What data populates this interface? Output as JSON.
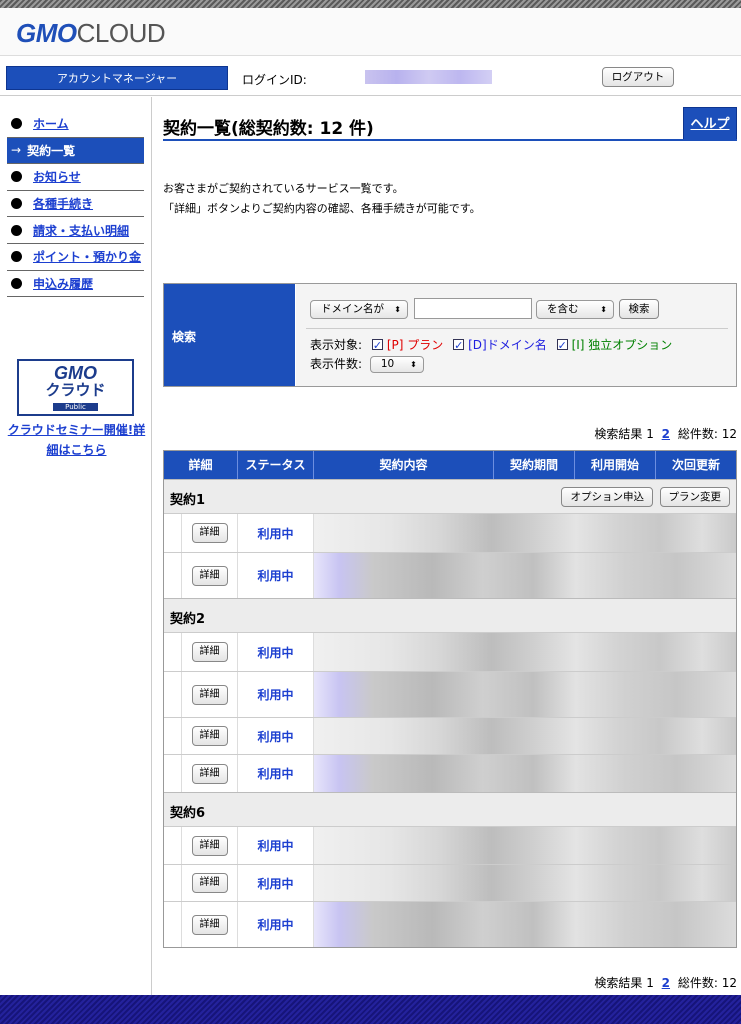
{
  "brand": {
    "gmo": "GMO",
    "cloud": "CLOUD"
  },
  "account": {
    "tab_label": "アカウントマネージャー",
    "login_label": "ログインID:",
    "logout_label": "ログアウト"
  },
  "sidebar": {
    "items": [
      {
        "label": "ホーム",
        "active": false
      },
      {
        "label": "契約一覧",
        "active": true
      },
      {
        "label": "お知らせ",
        "active": false
      },
      {
        "label": "各種手続き",
        "active": false
      },
      {
        "label": "請求・支払い明細",
        "active": false
      },
      {
        "label": "ポイント・預かり金",
        "active": false
      },
      {
        "label": "申込み履歴",
        "active": false
      }
    ],
    "active_arrow": "→",
    "badge": {
      "line1": "GMO",
      "line2": "クラウド",
      "line3": "Public"
    },
    "seminar_link": "クラウドセミナー開催!詳細はこちら"
  },
  "main": {
    "title": "契約一覧(総契約数: 12 件)",
    "help_label": "ヘルプ",
    "desc_line1": "お客さまがご契約されているサービス一覧です。",
    "desc_line2": "「詳細」ボタンよりご契約内容の確認、各種手続きが可能です。"
  },
  "search": {
    "label": "検索",
    "field_select": "ドメイン名が",
    "match_select": "を含む",
    "keyword_value": "",
    "search_button": "検索",
    "target_label": "表示対象:",
    "filters": {
      "plan": "[P] プラン",
      "domain": "[D]ドメイン名",
      "option": "[I] 独立オプション"
    },
    "count_label": "表示件数:",
    "count_value": "10"
  },
  "pagination": {
    "prefix": "検索結果",
    "page1": "1",
    "page2": "2",
    "total_label": "総件数:",
    "total": "12"
  },
  "table": {
    "headers": [
      "詳細",
      "ステータス",
      "契約内容",
      "契約期間",
      "利用開始",
      "次回更新"
    ],
    "option_button": "オプション申込",
    "plan_change_button": "プラン変更",
    "detail_label": "詳細",
    "groups": [
      {
        "name": "契約1",
        "rows": [
          {
            "status": "利用中"
          },
          {
            "status": "利用中"
          }
        ]
      },
      {
        "name": "契約2",
        "rows": [
          {
            "status": "利用中"
          },
          {
            "status": "利用中"
          },
          {
            "status": "利用中"
          },
          {
            "status": "利用中"
          }
        ]
      },
      {
        "name": "契約6",
        "rows": [
          {
            "status": "利用中"
          },
          {
            "status": "利用中"
          },
          {
            "status": "利用中"
          }
        ]
      }
    ]
  }
}
